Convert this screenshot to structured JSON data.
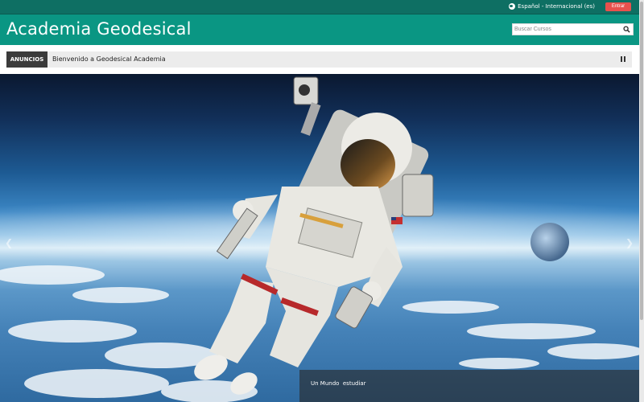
{
  "topbar": {
    "language": "Español - Internacional (es)",
    "login_label": "Entrar"
  },
  "header": {
    "site_title": "Academia Geodesical",
    "search_placeholder": "Buscar Cursos"
  },
  "announcements": {
    "label": "ANUNCIOS",
    "text": "Bienvenido a Geodesical Academia"
  },
  "slider": {
    "caption": "Un Mundo  estudiar",
    "prev_icon": "chevron-left-icon",
    "next_icon": "chevron-right-icon"
  },
  "colors": {
    "topbar": "#0e6f63",
    "header": "#0a9683",
    "login_button": "#e8514d",
    "announcement_label": "#3b3b3b"
  }
}
